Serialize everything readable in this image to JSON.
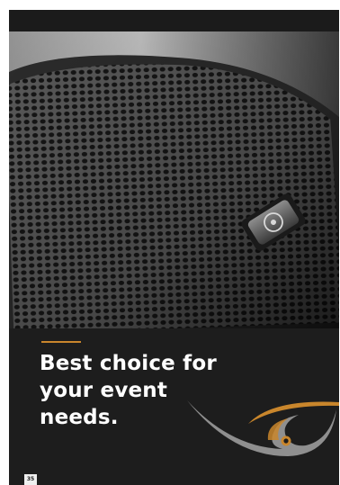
{
  "headline": {
    "line1": "Best choice for",
    "line2": "your event",
    "line3": "needs."
  },
  "page_number": "35",
  "colors": {
    "background": "#1d1d1d",
    "accent": "#c9862c",
    "text": "#ffffff",
    "swoosh": "#8f8f8f"
  },
  "photo": {
    "subject": "speaker-grille-with-logo-badge"
  }
}
